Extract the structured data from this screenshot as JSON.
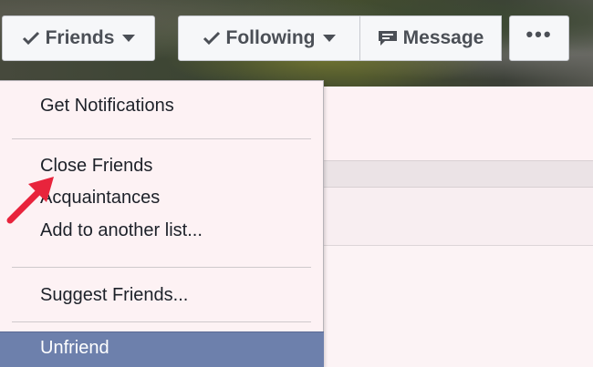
{
  "header": {
    "friends_label": "Friends",
    "following_label": "Following",
    "message_label": "Message",
    "more_label": "•••"
  },
  "menu": {
    "get_notifications": "Get Notifications",
    "close_friends": "Close Friends",
    "acquaintances": "Acquaintances",
    "add_to_list": "Add to another list...",
    "suggest_friends": "Suggest Friends...",
    "unfriend": "Unfriend"
  },
  "annotation": {
    "arrow_color": "#e8243c",
    "arrow_points_to": "Close Friends"
  },
  "colors": {
    "highlight": "#6d80ac",
    "button_bg": "#f6f7f9"
  }
}
